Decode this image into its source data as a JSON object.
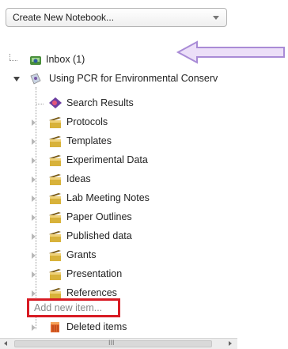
{
  "toolbar": {
    "notebook_dropdown": {
      "selected": "Create New Notebook..."
    }
  },
  "tree": {
    "inbox": {
      "label": "Inbox (1)",
      "icon": "inbox-icon"
    },
    "notebook": {
      "label": "Using PCR for Environmental Conserv",
      "icon": "notebook-icon",
      "items": [
        {
          "label": "Search Results",
          "icon": "search-results-icon"
        },
        {
          "label": "Protocols",
          "icon": "folder-icon"
        },
        {
          "label": "Templates",
          "icon": "folder-icon"
        },
        {
          "label": "Experimental Data",
          "icon": "folder-icon"
        },
        {
          "label": "Ideas",
          "icon": "folder-icon"
        },
        {
          "label": "Lab Meeting Notes",
          "icon": "folder-icon"
        },
        {
          "label": "Paper Outlines",
          "icon": "folder-icon"
        },
        {
          "label": "Published data",
          "icon": "folder-icon"
        },
        {
          "label": "Grants",
          "icon": "folder-icon"
        },
        {
          "label": "Presentation",
          "icon": "folder-icon"
        },
        {
          "label": "References",
          "icon": "folder-icon"
        }
      ],
      "add_new_item_placeholder": "Add new item...",
      "deleted": {
        "label": "Deleted items",
        "icon": "trash-icon"
      }
    }
  },
  "scrollbar": {
    "grip": "III"
  },
  "colors": {
    "highlight_box": "#d81b24",
    "arrow": "#a98bd6",
    "folder": "#d8b23a"
  }
}
